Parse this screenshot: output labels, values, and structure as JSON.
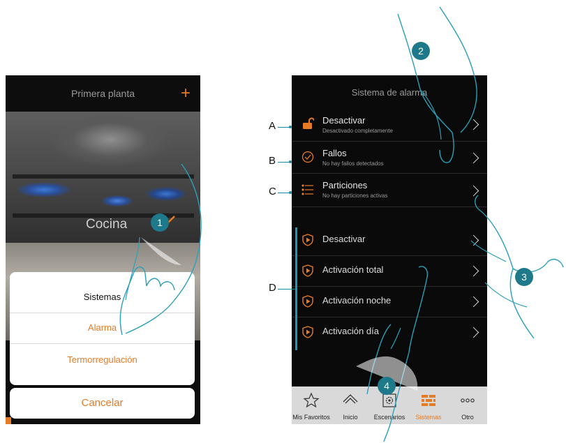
{
  "left_screen": {
    "header_title": "Primera planta",
    "add_symbol": "+",
    "room_label": "Cocina",
    "action_sheet": {
      "title": "Sistemas",
      "options": [
        "Alarma",
        "Termorregulación"
      ],
      "cancel_label": "Cancelar"
    }
  },
  "right_screen": {
    "header_title": "Sistema de alarma",
    "status_rows": [
      {
        "title": "Desactivar",
        "subtitle": "Desactivado completamente",
        "icon": "open-padlock-icon"
      },
      {
        "title": "Fallos",
        "subtitle": "No hay fallos detectados",
        "icon": "check-circle-icon"
      },
      {
        "title": "Particiones",
        "subtitle": "No hay particiones activas",
        "icon": "list-icon"
      }
    ],
    "scenarios": [
      {
        "label": "Desactivar",
        "icon": "shield-play-icon"
      },
      {
        "label": "Activación total",
        "icon": "shield-play-icon"
      },
      {
        "label": "Activación noche",
        "icon": "shield-play-icon"
      },
      {
        "label": "Activación día",
        "icon": "shield-play-icon"
      }
    ],
    "tabbar": [
      {
        "label": "Mis Favoritos",
        "icon": "star-icon",
        "active": false
      },
      {
        "label": "Inicio",
        "icon": "house-icon",
        "active": false
      },
      {
        "label": "Escenarios",
        "icon": "gear-icon",
        "active": false
      },
      {
        "label": "Sistemas",
        "icon": "bricks-icon",
        "active": true
      },
      {
        "label": "Otro",
        "icon": "dots-icon",
        "active": false
      }
    ]
  },
  "callouts": {
    "steps": [
      "1",
      "2",
      "3",
      "4"
    ],
    "letters": [
      "A",
      "B",
      "C",
      "D"
    ]
  },
  "colors": {
    "accent": "#e67b26",
    "callout": "#1e7a8a",
    "screen_bg": "#0a0a0a",
    "tabbar_bg": "#d9d9d9"
  }
}
